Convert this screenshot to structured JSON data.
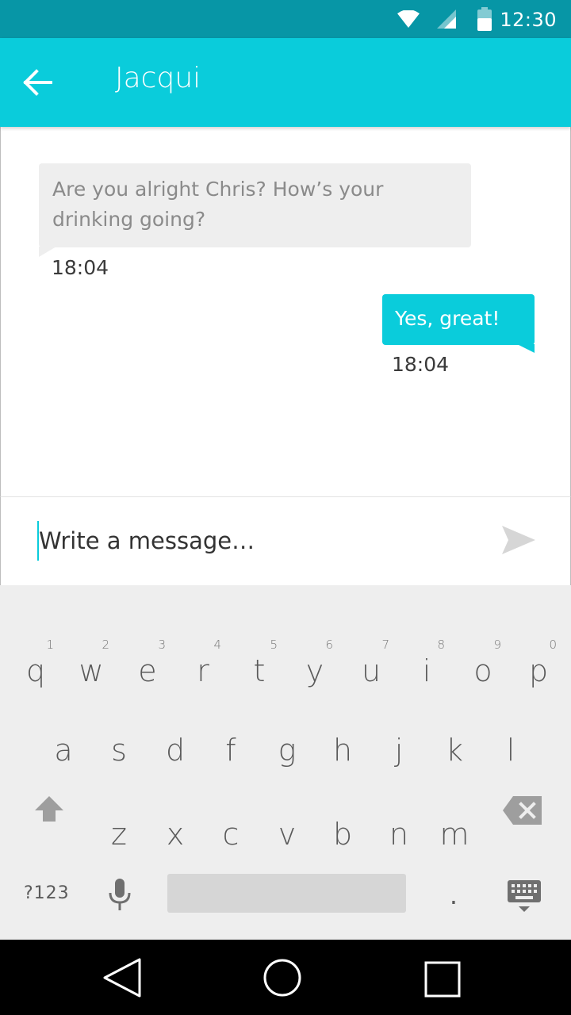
{
  "status_bar": {
    "time": "12:30",
    "icons": [
      "wifi-icon",
      "cell-signal-icon",
      "battery-icon"
    ]
  },
  "app_bar": {
    "title": "Jacqui",
    "back_icon": "arrow-back-icon"
  },
  "messages": [
    {
      "direction": "incoming",
      "text": "Are you alright Chris? How’s your drinking going?",
      "time": "18:04"
    },
    {
      "direction": "outgoing",
      "text": "Yes, great!",
      "time": "18:04"
    }
  ],
  "compose": {
    "placeholder": "Write a message…",
    "send_icon": "send-icon"
  },
  "keyboard": {
    "row1": [
      {
        "key": "q",
        "hint": "1"
      },
      {
        "key": "w",
        "hint": "2"
      },
      {
        "key": "e",
        "hint": "3"
      },
      {
        "key": "r",
        "hint": "4"
      },
      {
        "key": "t",
        "hint": "5"
      },
      {
        "key": "y",
        "hint": "6"
      },
      {
        "key": "u",
        "hint": "7"
      },
      {
        "key": "i",
        "hint": "8"
      },
      {
        "key": "o",
        "hint": "9"
      },
      {
        "key": "p",
        "hint": "0"
      }
    ],
    "row2": [
      "a",
      "s",
      "d",
      "f",
      "g",
      "h",
      "j",
      "k",
      "l"
    ],
    "row3": [
      "z",
      "x",
      "c",
      "v",
      "b",
      "n",
      "m"
    ],
    "symbols_label": "?123",
    "period_label": "."
  },
  "nav_bar": {
    "icons": [
      "back-triangle-icon",
      "home-circle-icon",
      "recents-square-icon"
    ]
  },
  "colors": {
    "status_bar": "#0796a6",
    "accent": "#0accdb",
    "incoming_bubble": "#eeeeee",
    "keyboard_bg": "#eeeeee"
  }
}
